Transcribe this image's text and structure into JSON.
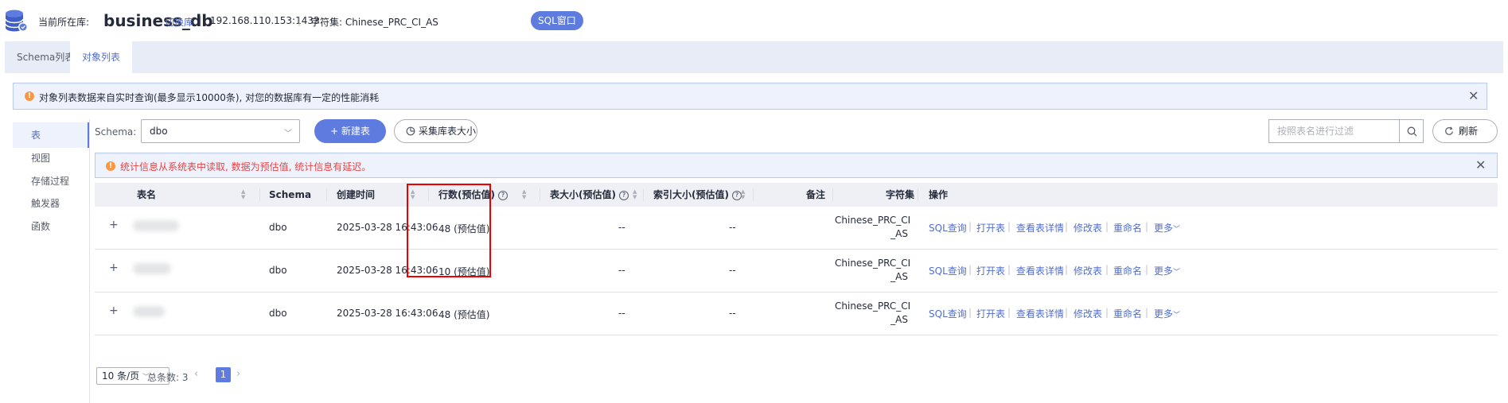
{
  "header": {
    "current_db_label": "当前所在库:",
    "db_name": "business_db",
    "switch_db": "切换库",
    "host": "192.168.110.153:1433",
    "charset_label": "字符集: Chinese_PRC_CI_AS",
    "sql_window": "SQL窗口"
  },
  "tabs": [
    {
      "label": "Schema列表",
      "active": false
    },
    {
      "label": "对象列表",
      "active": true
    }
  ],
  "info_alert": "对象列表数据来自实时查询(最多显示10000条), 对您的数据库有一定的性能消耗",
  "sidebar": [
    {
      "label": "表",
      "active": true
    },
    {
      "label": "视图"
    },
    {
      "label": "存储过程"
    },
    {
      "label": "触发器"
    },
    {
      "label": "函数"
    }
  ],
  "toolbar": {
    "schema_label": "Schema:",
    "schema_value": "dbo",
    "new_table": "+ 新建表",
    "collect_size": "采集库表大小",
    "search_placeholder": "按照表名进行过滤",
    "refresh": "刷新"
  },
  "stats_alert": "统计信息从系统表中读取, 数据为预估值, 统计信息有延迟。",
  "table": {
    "columns": [
      "表名",
      "Schema",
      "创建时间",
      "行数(预估值)",
      "表大小(预估值)",
      "索引大小(预估值)",
      "备注",
      "字符集",
      "操作"
    ],
    "rows": [
      {
        "schema": "dbo",
        "created": "2025-03-28 16:43:06",
        "rows": "48 (预估值)",
        "size": "--",
        "index_size": "--",
        "charset_l1": "Chinese_PRC_CI",
        "charset_l2": "_AS"
      },
      {
        "schema": "dbo",
        "created": "2025-03-28 16:43:06",
        "rows": "10 (预估值)",
        "size": "--",
        "index_size": "--",
        "charset_l1": "Chinese_PRC_CI",
        "charset_l2": "_AS"
      },
      {
        "schema": "dbo",
        "created": "2025-03-28 16:43:06",
        "rows": "48 (预估值)",
        "size": "--",
        "index_size": "--",
        "charset_l1": "Chinese_PRC_CI",
        "charset_l2": "_AS"
      }
    ],
    "ops": [
      "SQL查询",
      "打开表",
      "查看表详情",
      "修改表",
      "重命名",
      "更多"
    ]
  },
  "pager": {
    "page_size": "10 条/页",
    "total_label": "总条数: 3",
    "current_page": "1"
  },
  "colors": {
    "accent": "#5e7ce0",
    "link": "#526ecc",
    "warning": "#fa9841",
    "danger": "#e54545",
    "highlight_box": "#e00000"
  }
}
